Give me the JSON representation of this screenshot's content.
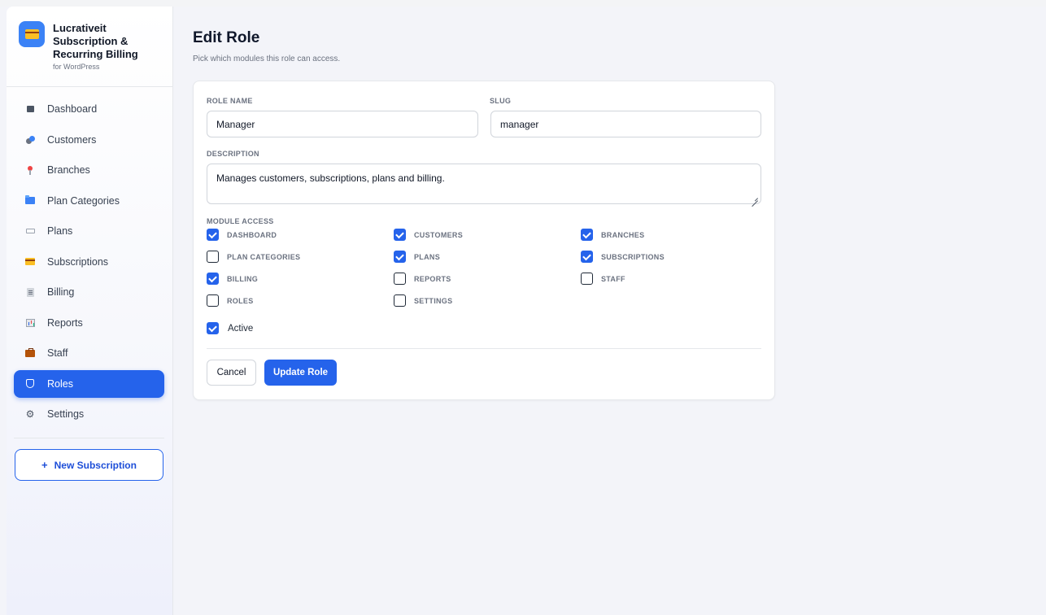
{
  "brand": {
    "title": "Lucrativeit Subscription & Recurring Billing",
    "subtitle": "for WordPress"
  },
  "nav": {
    "items": [
      {
        "label": "Dashboard",
        "icon": "dashboard-icon"
      },
      {
        "label": "Customers",
        "icon": "users-icon"
      },
      {
        "label": "Branches",
        "icon": "pin-icon"
      },
      {
        "label": "Plan Categories",
        "icon": "folder-icon"
      },
      {
        "label": "Plans",
        "icon": "tag-icon"
      },
      {
        "label": "Subscriptions",
        "icon": "credit-card-icon"
      },
      {
        "label": "Billing",
        "icon": "receipt-icon"
      },
      {
        "label": "Reports",
        "icon": "bar-chart-icon"
      },
      {
        "label": "Staff",
        "icon": "briefcase-icon"
      },
      {
        "label": "Roles",
        "icon": "shield-icon",
        "active": true
      },
      {
        "label": "Settings",
        "icon": "gear-icon"
      }
    ],
    "new_subscription": "New Subscription"
  },
  "page": {
    "title": "Edit Role",
    "subtitle": "Pick which modules this role can access."
  },
  "form": {
    "role_name_label": "ROLE NAME",
    "role_name_value": "Manager",
    "slug_label": "SLUG",
    "slug_value": "manager",
    "description_label": "DESCRIPTION",
    "description_value": "Manages customers, subscriptions, plans and billing.",
    "module_access_label": "MODULE ACCESS",
    "modules": [
      {
        "label": "DASHBOARD",
        "checked": true
      },
      {
        "label": "CUSTOMERS",
        "checked": true
      },
      {
        "label": "BRANCHES",
        "checked": true
      },
      {
        "label": "PLAN CATEGORIES",
        "checked": false
      },
      {
        "label": "PLANS",
        "checked": true
      },
      {
        "label": "SUBSCRIPTIONS",
        "checked": true
      },
      {
        "label": "BILLING",
        "checked": true
      },
      {
        "label": "REPORTS",
        "checked": false
      },
      {
        "label": "STAFF",
        "checked": false
      },
      {
        "label": "ROLES",
        "checked": false
      },
      {
        "label": "SETTINGS",
        "checked": false
      }
    ],
    "active_label": "Active",
    "active_checked": true,
    "cancel_label": "Cancel",
    "update_label": "Update Role"
  },
  "colors": {
    "accent": "#2563eb",
    "background": "#f3f4f9"
  }
}
